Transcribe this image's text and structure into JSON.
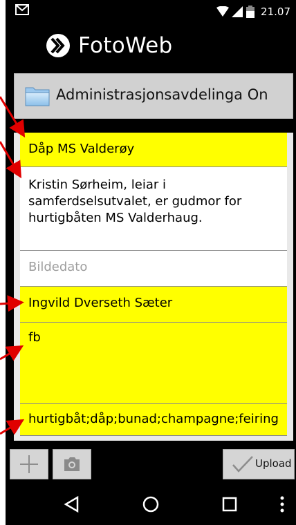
{
  "status_bar": {
    "time": "21.07",
    "icons": [
      "gmail-icon",
      "wifi-icon",
      "signal-icon",
      "battery-icon"
    ]
  },
  "app": {
    "title": "FotoWeb",
    "logo": "fotoweb-logo-icon"
  },
  "folder": {
    "icon": "folder-icon",
    "label": "Administrasjonsavdelinga On"
  },
  "form": {
    "fields": [
      {
        "value": "Dåp MS Valderøy",
        "style": "yellow"
      },
      {
        "value": "Kristin Sørheim, leiar i samferdselsutvalet, er gudmor for hurtigbåten MS Valderhaug.",
        "style": "white"
      },
      {
        "value": "",
        "placeholder": "Bildedato",
        "style": "white"
      },
      {
        "value": "Ingvild Dverseth Sæter",
        "style": "yellow"
      },
      {
        "value": "fb",
        "style": "yellow"
      },
      {
        "value": "hurtigbåt;dåp;bunad;champagne;feiring",
        "style": "yellow"
      }
    ]
  },
  "toolbar": {
    "add_icon": "plus-icon",
    "camera_icon": "camera-icon",
    "upload_label": "Upload",
    "upload_icon": "checkmark-icon"
  },
  "navbar": {
    "items": [
      "back-icon",
      "home-icon",
      "recents-icon",
      "overflow-menu-icon"
    ]
  },
  "colors": {
    "field_highlight": "#ffff00",
    "annotation_arrow": "#e00000",
    "background": "#000000"
  }
}
